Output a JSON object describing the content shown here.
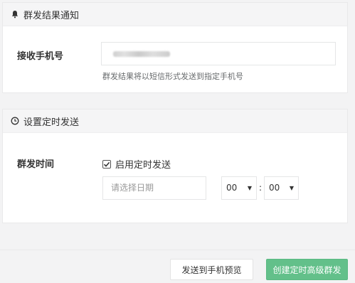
{
  "notify": {
    "title": "群发结果通知",
    "icon": "bell-icon",
    "label": "接收手机号",
    "help": "群发结果将以短信形式发送到指定手机号"
  },
  "timer": {
    "title": "设置定时发送",
    "icon": "clock-icon",
    "label": "群发时间",
    "checkbox_label": "启用定时发送",
    "checkbox_checked": true,
    "date_placeholder": "请选择日期",
    "hour": "00",
    "minute": "00",
    "colon": ":"
  },
  "footer": {
    "preview_label": "发送到手机预览",
    "create_label": "创建定时高级群发"
  },
  "colors": {
    "primary_green": "#63c08a",
    "page_bg": "#f3f3f4",
    "panel_header_bg": "#f5f5f6"
  }
}
